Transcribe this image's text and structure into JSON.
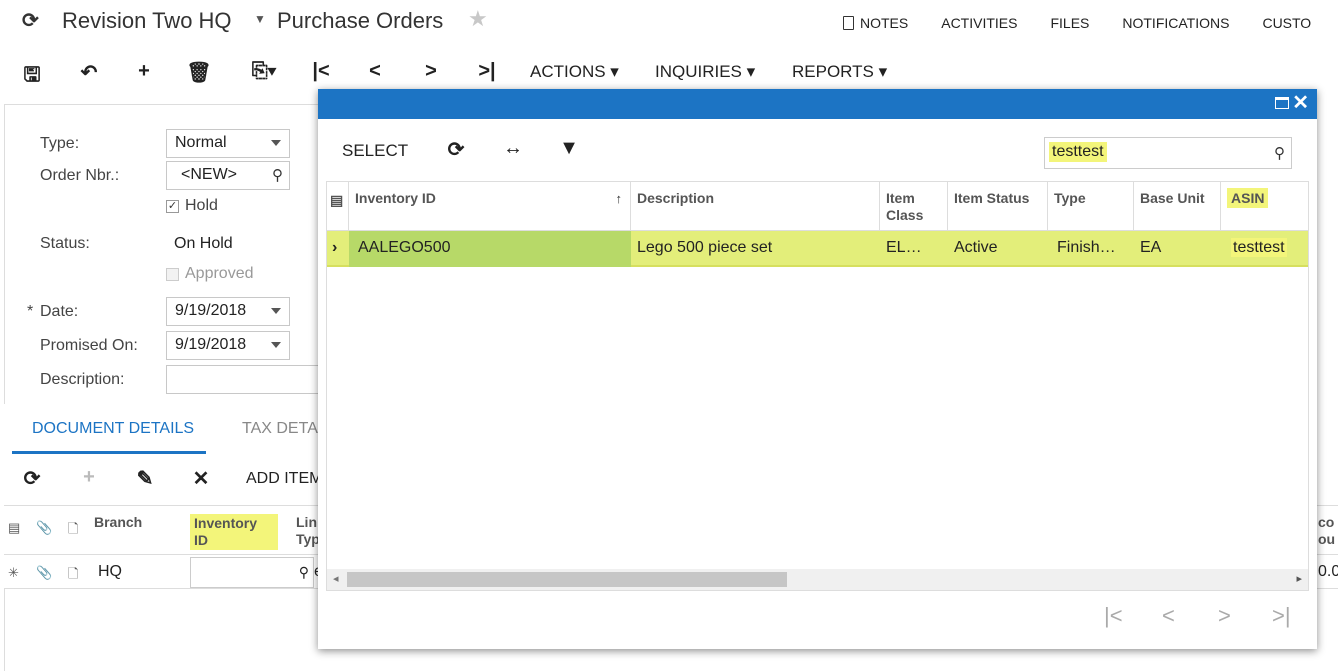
{
  "header": {
    "company": "Revision Two HQ",
    "screen_title": "Purchase Orders",
    "links": [
      "NOTES",
      "ACTIVITIES",
      "FILES",
      "NOTIFICATIONS",
      "CUSTO"
    ]
  },
  "toolbar": {
    "menus": [
      "ACTIONS",
      "INQUIRIES",
      "REPORTS"
    ]
  },
  "form": {
    "type_label": "Type:",
    "type_value": "Normal",
    "order_nbr_label": "Order Nbr.:",
    "order_nbr_value": "<NEW>",
    "hold_label": "Hold",
    "status_label": "Status:",
    "status_value": "On Hold",
    "approved_label": "Approved",
    "date_label": "Date:",
    "date_value": "9/19/2018",
    "promised_label": "Promised On:",
    "promised_value": "9/19/2018",
    "description_label": "Description:",
    "description_value": ""
  },
  "tabs": [
    "DOCUMENT DETAILS",
    "TAX DETA"
  ],
  "grid_toolbar": {
    "add_item": "ADD ITEM"
  },
  "bottom_grid": {
    "columns": [
      "Branch",
      "Inventory ID",
      "Lin Typ",
      "co ou"
    ],
    "row": {
      "branch": "HQ",
      "line_type_fragment": "e",
      "last_fragment": "0.0"
    }
  },
  "lookup": {
    "select_label": "SELECT",
    "search_value": "testtest",
    "columns": [
      "Inventory ID",
      "Description",
      "Item Class",
      "Item Status",
      "Type",
      "Base Unit",
      "ASIN"
    ],
    "rows": [
      {
        "inventory_id": "AALEGO500",
        "description": "Lego 500 piece set",
        "item_class": "EL…",
        "item_status": "Active",
        "type": "Finish…",
        "base_unit": "EA",
        "asin": "testtest"
      }
    ]
  },
  "colors": {
    "accent": "#1c74c4",
    "highlight": "#f3f57a",
    "selected_row": "#e3ee7a",
    "selected_key": "#b7d968"
  }
}
